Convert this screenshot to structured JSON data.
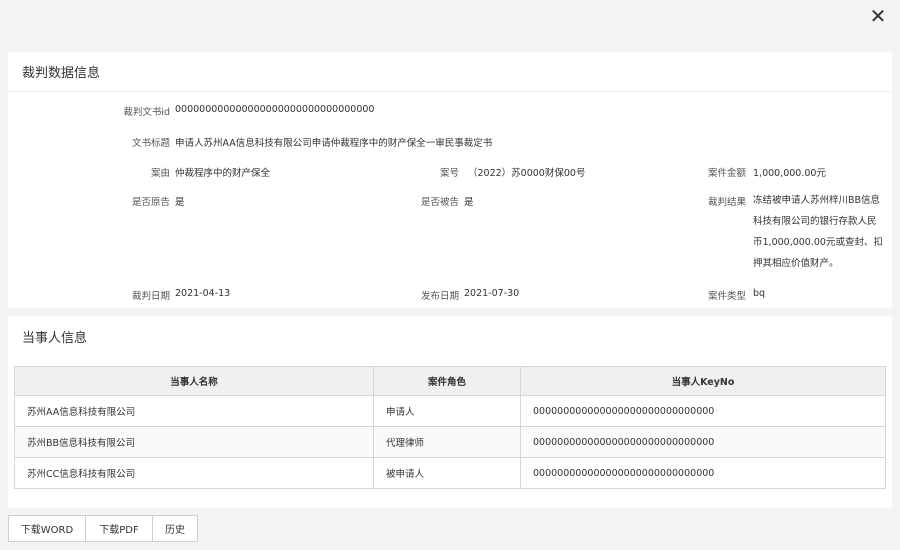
{
  "header": {
    "close_icon": "close-icon"
  },
  "judgment": {
    "title": "裁判数据信息",
    "fields": {
      "doc_id": {
        "label": "裁判文书id",
        "value": "000000000000000000000000000000000"
      },
      "doc_title": {
        "label": "文书标题",
        "value": "申请人苏州AA信息科技有限公司申请仲裁程序中的财产保全一审民事裁定书"
      },
      "cause": {
        "label": "案由",
        "value": "仲裁程序中的财产保全"
      },
      "case_no": {
        "label": "案号",
        "value": "（2022）苏0000财保00号"
      },
      "amount": {
        "label": "案件金额",
        "value": "1,000,000.00元"
      },
      "is_plaintiff": {
        "label": "是否原告",
        "value": "是"
      },
      "is_defendant": {
        "label": "是否被告",
        "value": "是"
      },
      "result": {
        "label": "裁判结果",
        "value": "冻结被申请人苏州梓川BB信息科技有限公司的银行存款人民币1,000,000.00元或查封、扣押其相应价值财产。"
      },
      "judgment_date": {
        "label": "裁判日期",
        "value": "2021-04-13"
      },
      "publish_date": {
        "label": "发布日期",
        "value": "2021-07-30"
      },
      "case_type": {
        "label": "案件类型",
        "value": "bq"
      }
    }
  },
  "parties": {
    "title": "当事人信息",
    "columns": [
      "当事人名称",
      "案件角色",
      "当事人KeyNo"
    ],
    "rows": [
      [
        "苏州AA信息科技有限公司",
        "申请人",
        "000000000000000000000000000000"
      ],
      [
        "苏州BB信息科技有限公司",
        "代理律师",
        "000000000000000000000000000000"
      ],
      [
        "苏州CC信息科技有限公司",
        "被申请人",
        "000000000000000000000000000000"
      ]
    ]
  },
  "footer": {
    "buttons": [
      "下载WORD",
      "下载PDF",
      "历史"
    ]
  }
}
